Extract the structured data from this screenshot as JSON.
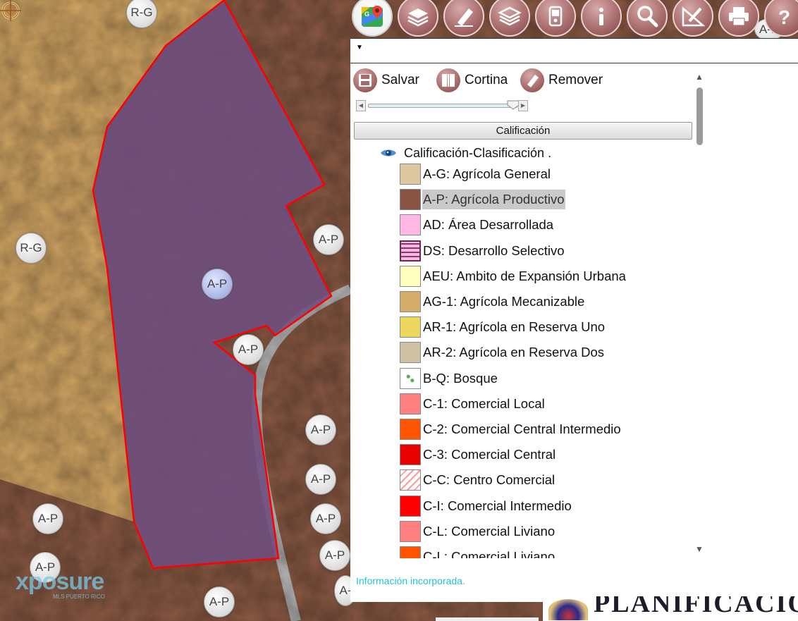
{
  "map": {
    "zone_labels": [
      {
        "id": "rg-top",
        "text": "R-G"
      },
      {
        "id": "rg-left",
        "text": "R-G"
      },
      {
        "id": "ap-selected",
        "text": "A-P"
      },
      {
        "id": "ap-right",
        "text": "A-P"
      },
      {
        "id": "ap-notch",
        "text": "A-P"
      },
      {
        "id": "ap-r1",
        "text": "A-P"
      },
      {
        "id": "ap-r2",
        "text": "A-P"
      },
      {
        "id": "ap-r3",
        "text": "A-P"
      },
      {
        "id": "ap-r4",
        "text": "A-P"
      },
      {
        "id": "ap-left1",
        "text": "A-P"
      },
      {
        "id": "ap-left2",
        "text": "A-P"
      },
      {
        "id": "ap-bottom",
        "text": "A-P"
      },
      {
        "id": "ap-edge",
        "text": "A-"
      },
      {
        "id": "ap-topright",
        "text": "A-P"
      }
    ],
    "watermark": "xposure",
    "watermark_sub": "MLS PUERTO RICO",
    "colors": {
      "agricola_general": "#d8b36d",
      "agricola_productivo": "#8b5a44",
      "selected_fill": "#6e4f7f",
      "selected_outline": "#ff0000"
    }
  },
  "toolbar": {
    "tools": [
      "google-maps-icon",
      "layers-icon",
      "eraser-icon",
      "layers-stack-icon",
      "gps-device-icon",
      "info-icon",
      "search-icon",
      "measure-icon",
      "print-icon",
      "help-icon"
    ]
  },
  "panel": {
    "actions": {
      "save": "Salvar",
      "curtain": "Cortina",
      "remove": "Remover"
    },
    "layer_header": "Calificación",
    "tree_title": "Calificación-Clasificación .",
    "legend": [
      {
        "label": "A-G: Agrícola General",
        "color": "#ddc7a0",
        "pattern": "solid"
      },
      {
        "label": "A-P: Agrícola Productivo",
        "color": "#8a5444",
        "pattern": "solid",
        "highlight": true
      },
      {
        "label": "AD: Área Desarrollada",
        "color": "#ffb8e6",
        "pattern": "solid"
      },
      {
        "label": "DS: Desarrollo Selectivo",
        "color": "#f7b7e4",
        "pattern": "stripes"
      },
      {
        "label": "AEU: Ambito de Expansión Urbana",
        "color": "#ffffc0",
        "pattern": "solid"
      },
      {
        "label": "AG-1: Agrícola Mecanizable",
        "color": "#d4ad6a",
        "pattern": "solid"
      },
      {
        "label": "AR-1: Agrícola en Reserva Uno",
        "color": "#ecd75e",
        "pattern": "solid"
      },
      {
        "label": "AR-2: Agrícola en Reserva Dos",
        "color": "#cfc1a4",
        "pattern": "solid"
      },
      {
        "label": "B-Q: Bosque",
        "color": "#ffffff",
        "pattern": "dots"
      },
      {
        "label": "C-1: Comercial Local",
        "color": "#ff8080",
        "pattern": "solid"
      },
      {
        "label": "C-2: Comercial Central Intermedio",
        "color": "#ff5500",
        "pattern": "solid"
      },
      {
        "label": "C-3: Comercial Central",
        "color": "#e60000",
        "pattern": "solid"
      },
      {
        "label": "C-C: Centro Comercial",
        "color": "#ffffff",
        "pattern": "hatch"
      },
      {
        "label": "C-I: Comercial Intermedio",
        "color": "#ff0000",
        "pattern": "solid"
      },
      {
        "label": "C-L: Comercial Liviano",
        "color": "#ff8080",
        "pattern": "solid"
      },
      {
        "label": "C-L: Comercial Liviano",
        "color": "#ff5500",
        "pattern": "solid",
        "partial": true
      }
    ],
    "status": "Información incorporada."
  },
  "banner": {
    "text": "PLANIFICACION"
  }
}
